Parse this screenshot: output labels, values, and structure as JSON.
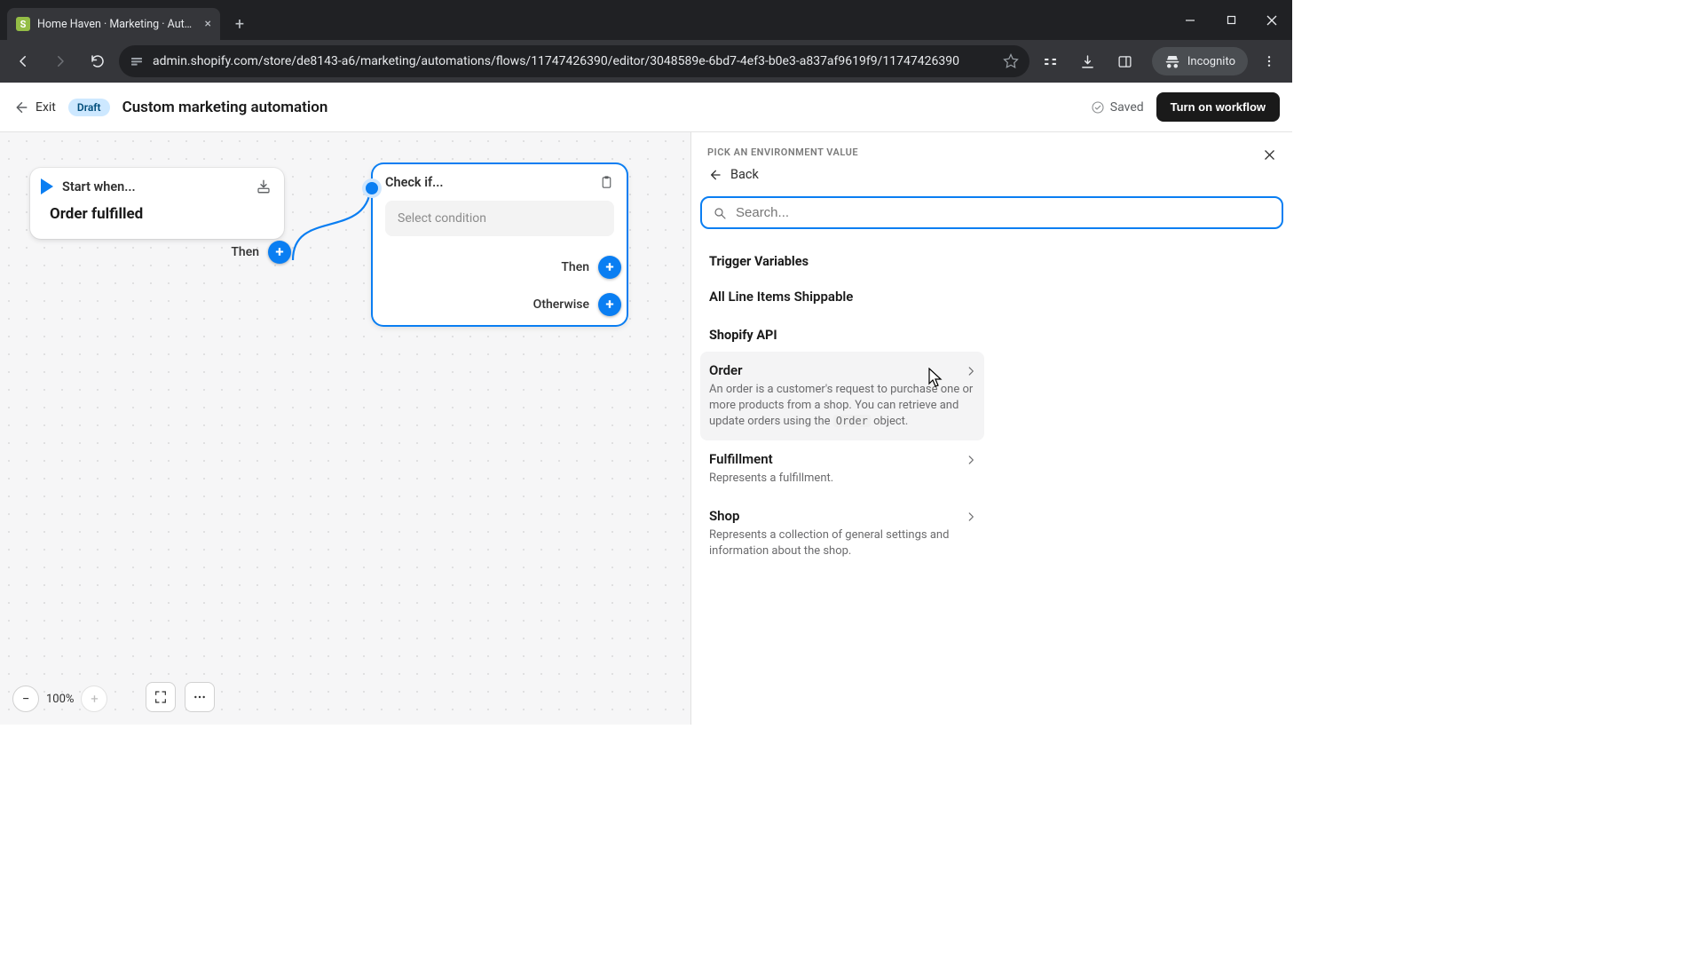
{
  "browser": {
    "tab_title": "Home Haven · Marketing · Aut…",
    "url": "admin.shopify.com/store/de8143-a6/marketing/automations/flows/11747426390/editor/3048589e-6bd7-4ef3-b0e3-a837af9619f9/11747426390",
    "incognito_label": "Incognito"
  },
  "appbar": {
    "exit": "Exit",
    "badge": "Draft",
    "title": "Custom marketing automation",
    "saved": "Saved",
    "primary": "Turn on workflow"
  },
  "canvas": {
    "start_head": "Start when...",
    "start_trigger": "Order fulfilled",
    "start_then": "Then",
    "check_head": "Check if...",
    "check_placeholder": "Select condition",
    "check_then": "Then",
    "check_otherwise": "Otherwise",
    "zoom": "100%"
  },
  "panel": {
    "kicker": "PICK AN ENVIRONMENT VALUE",
    "back": "Back",
    "search_placeholder": "Search...",
    "section_trigger": "Trigger Variables",
    "item_all_line": "All Line Items Shippable",
    "section_api": "Shopify API",
    "order_title": "Order",
    "order_desc_pre": "An order is a customer's request to purchase one or more products from a shop. You can retrieve and update orders using the ",
    "order_code": "Order",
    "order_desc_post": " object.",
    "fulfillment_title": "Fulfillment",
    "fulfillment_desc": "Represents a fulfillment.",
    "shop_title": "Shop",
    "shop_desc": "Represents a collection of general settings and information about the shop."
  }
}
